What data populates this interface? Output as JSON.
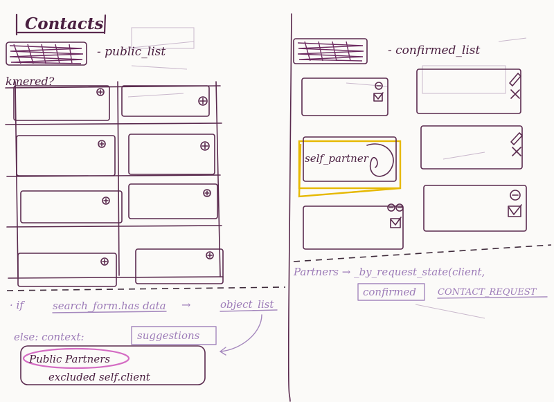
{
  "left_panel": {
    "title": "Contacts",
    "list_label": "- public_list",
    "question_label": "kmered?",
    "card_icon": "plus-circle-icon"
  },
  "right_panel": {
    "list_label": "- confirmed_list",
    "self_partner_label": "self_partner",
    "card_icons": [
      "minus-circle-icon",
      "checkbox-icon",
      "pencil-icon",
      "cross-icon"
    ]
  },
  "notes": {
    "if_line": {
      "prefix": "· if",
      "condition": "search_form.has data",
      "arrow": "→",
      "target": "object_list"
    },
    "else_line": {
      "prefix": "else: context:",
      "suggestions": "suggestions"
    },
    "public_partners": "Public Partners",
    "excluded": "excluded self.client",
    "partners_line": "Partners → _by_request_state(client,",
    "confirmed": "confirmed",
    "contact_request": "CONTACT_REQUEST"
  },
  "colors": {
    "ink": "#5a2a4e",
    "note_ink": "#9d7cb8",
    "highlight_pink": "#d46cc3",
    "highlight_yellow": "#e6b800"
  }
}
